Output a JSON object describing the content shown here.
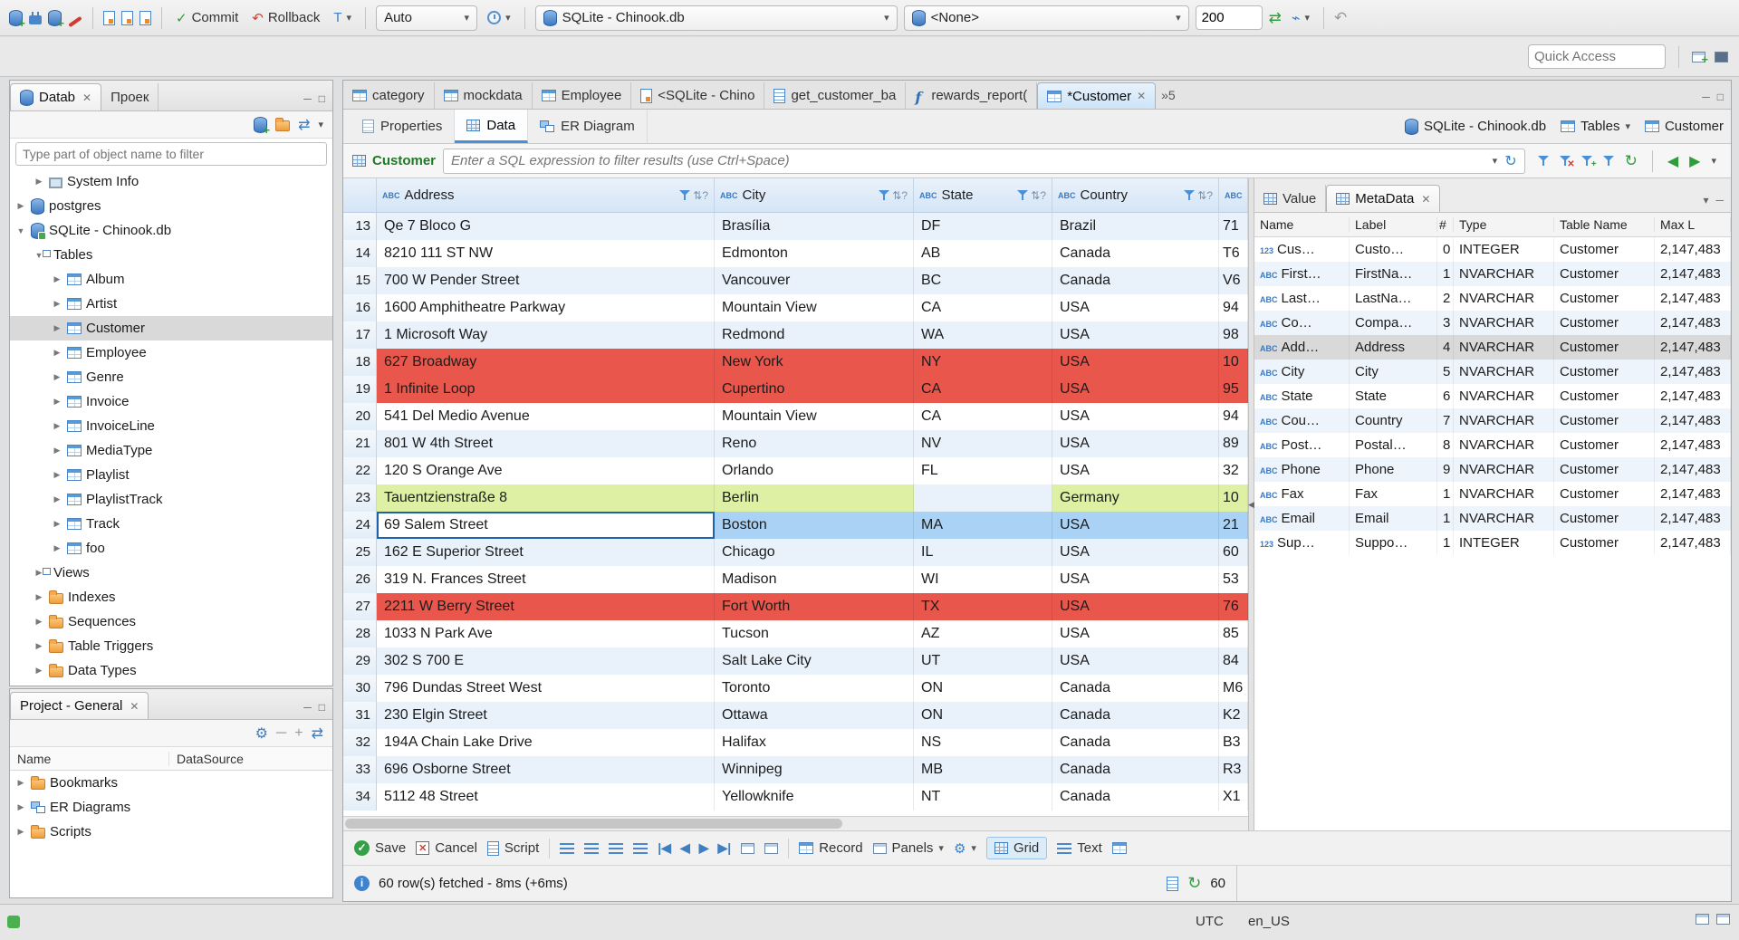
{
  "icons": {
    "caret_down": "▾",
    "close": "✕",
    "check": "✓",
    "minimize": "─",
    "restore": "□",
    "sort": "⇅?",
    "nav_first": "|◀",
    "nav_prev": "◀",
    "nav_next": "▶",
    "nav_last": "▶|",
    "refresh": "↻",
    "gear": "⚙",
    "info": "i",
    "undo": "↶",
    "back_arrow": "◀",
    "forward_arrow": "▶",
    "splitter_arrow": "◀",
    "swap": "⇄",
    "x_small": "✕",
    "plus_small": "+"
  },
  "toolbar": {
    "commit_label": "Commit",
    "rollback_label": "Rollback",
    "txn_label": "T",
    "auto_label": "Auto",
    "db_combo": "SQLite - Chinook.db",
    "schema_combo": "<None>",
    "fetch_size": "200",
    "quick_access_placeholder": "Quick Access"
  },
  "navigator": {
    "db_tab": "Datab",
    "project_tab": "Проек",
    "filter_placeholder": "Type part of object name to filter",
    "tree": [
      {
        "label": "System Info",
        "depth": 1,
        "arrow": "▶",
        "icon": "sysinfo"
      },
      {
        "label": "postgres",
        "depth": 0,
        "arrow": "▶",
        "icon": "db"
      },
      {
        "label": "SQLite - Chinook.db",
        "depth": 0,
        "arrow": "▼",
        "icon": "db-active"
      },
      {
        "label": "Tables",
        "depth": 1,
        "arrow": "▼",
        "icon": "folder-tables"
      },
      {
        "label": "Album",
        "depth": 2,
        "arrow": "▶",
        "icon": "table"
      },
      {
        "label": "Artist",
        "depth": 2,
        "arrow": "▶",
        "icon": "table"
      },
      {
        "label": "Customer",
        "depth": 2,
        "arrow": "▶",
        "icon": "table",
        "selected": true
      },
      {
        "label": "Employee",
        "depth": 2,
        "arrow": "▶",
        "icon": "table"
      },
      {
        "label": "Genre",
        "depth": 2,
        "arrow": "▶",
        "icon": "table"
      },
      {
        "label": "Invoice",
        "depth": 2,
        "arrow": "▶",
        "icon": "table"
      },
      {
        "label": "InvoiceLine",
        "depth": 2,
        "arrow": "▶",
        "icon": "table"
      },
      {
        "label": "MediaType",
        "depth": 2,
        "arrow": "▶",
        "icon": "table"
      },
      {
        "label": "Playlist",
        "depth": 2,
        "arrow": "▶",
        "icon": "table"
      },
      {
        "label": "PlaylistTrack",
        "depth": 2,
        "arrow": "▶",
        "icon": "table"
      },
      {
        "label": "Track",
        "depth": 2,
        "arrow": "▶",
        "icon": "table"
      },
      {
        "label": "foo",
        "depth": 2,
        "arrow": "▶",
        "icon": "table"
      },
      {
        "label": "Views",
        "depth": 1,
        "arrow": "▶",
        "icon": "folder-views"
      },
      {
        "label": "Indexes",
        "depth": 1,
        "arrow": "▶",
        "icon": "folder"
      },
      {
        "label": "Sequences",
        "depth": 1,
        "arrow": "▶",
        "icon": "folder"
      },
      {
        "label": "Table Triggers",
        "depth": 1,
        "arrow": "▶",
        "icon": "folder"
      },
      {
        "label": "Data Types",
        "depth": 1,
        "arrow": "▶",
        "icon": "folder"
      }
    ]
  },
  "project_panel": {
    "title": "Project - General",
    "name_col": "Name",
    "datasource_col": "DataSource",
    "items": [
      {
        "label": "Bookmarks",
        "icon": "folder"
      },
      {
        "label": "ER Diagrams",
        "icon": "diagram"
      },
      {
        "label": "Scripts",
        "icon": "folder"
      }
    ]
  },
  "editor": {
    "tabs": [
      {
        "label": "category",
        "icon": "table"
      },
      {
        "label": "mockdata",
        "icon": "table"
      },
      {
        "label": "Employee",
        "icon": "table"
      },
      {
        "label": "<SQLite - Chino",
        "icon": "sql"
      },
      {
        "label": "get_customer_ba",
        "icon": "script"
      },
      {
        "label": "rewards_report(",
        "icon": "function"
      },
      {
        "label": "*Customer",
        "icon": "table",
        "active": true,
        "closable": true
      }
    ],
    "overflow": "»5",
    "subtabs": [
      {
        "label": "Properties",
        "icon": "props"
      },
      {
        "label": "Data",
        "icon": "grid",
        "active": true
      },
      {
        "label": "ER Diagram",
        "icon": "er"
      }
    ],
    "context_db": "SQLite - Chinook.db",
    "context_container": "Tables",
    "context_entity": "Customer"
  },
  "filter_bar": {
    "entity": "Customer",
    "placeholder": "Enter a SQL expression to filter results (use Ctrl+Space)"
  },
  "grid": {
    "columns": [
      {
        "label": "Address",
        "type": "ABC"
      },
      {
        "label": "City",
        "type": "ABC"
      },
      {
        "label": "State",
        "type": "ABC"
      },
      {
        "label": "Country",
        "type": "ABC"
      },
      {
        "label": "",
        "type": "ABC"
      }
    ],
    "rows": [
      {
        "num": "13",
        "address": "Qe 7 Bloco G",
        "city": "Brasília",
        "state": "DF",
        "country": "Brazil",
        "postal": "71",
        "hl": "odd"
      },
      {
        "num": "14",
        "address": "8210 111 ST NW",
        "city": "Edmonton",
        "state": "AB",
        "country": "Canada",
        "postal": "T6",
        "hl": "even"
      },
      {
        "num": "15",
        "address": "700 W Pender Street",
        "city": "Vancouver",
        "state": "BC",
        "country": "Canada",
        "postal": "V6",
        "hl": "odd"
      },
      {
        "num": "16",
        "address": "1600 Amphitheatre Parkway",
        "city": "Mountain View",
        "state": "CA",
        "country": "USA",
        "postal": "94",
        "hl": "even"
      },
      {
        "num": "17",
        "address": "1 Microsoft Way",
        "city": "Redmond",
        "state": "WA",
        "country": "USA",
        "postal": "98",
        "hl": "odd"
      },
      {
        "num": "18",
        "address": "627 Broadway",
        "city": "New York",
        "state": "NY",
        "country": "USA",
        "postal": "10",
        "hl": "red"
      },
      {
        "num": "19",
        "address": "1 Infinite Loop",
        "city": "Cupertino",
        "state": "CA",
        "country": "USA",
        "postal": "95",
        "hl": "red"
      },
      {
        "num": "20",
        "address": "541 Del Medio Avenue",
        "city": "Mountain View",
        "state": "CA",
        "country": "USA",
        "postal": "94",
        "hl": "even"
      },
      {
        "num": "21",
        "address": "801 W 4th Street",
        "city": "Reno",
        "state": "NV",
        "country": "USA",
        "postal": "89",
        "hl": "odd"
      },
      {
        "num": "22",
        "address": "120 S Orange Ave",
        "city": "Orlando",
        "state": "FL",
        "country": "USA",
        "postal": "32",
        "hl": "even"
      },
      {
        "num": "23",
        "address": "Tauentzienstraße 8",
        "city": "Berlin",
        "state": "",
        "country": "Germany",
        "postal": "10",
        "hl": "green"
      },
      {
        "num": "24",
        "address": "69 Salem Street",
        "city": "Boston",
        "state": "MA",
        "country": "USA",
        "postal": "21",
        "hl": "selected"
      },
      {
        "num": "25",
        "address": "162 E Superior Street",
        "city": "Chicago",
        "state": "IL",
        "country": "USA",
        "postal": "60",
        "hl": "odd"
      },
      {
        "num": "26",
        "address": "319 N. Frances Street",
        "city": "Madison",
        "state": "WI",
        "country": "USA",
        "postal": "53",
        "hl": "even"
      },
      {
        "num": "27",
        "address": "2211 W Berry Street",
        "city": "Fort Worth",
        "state": "TX",
        "country": "USA",
        "postal": "76",
        "hl": "red"
      },
      {
        "num": "28",
        "address": "1033 N Park Ave",
        "city": "Tucson",
        "state": "AZ",
        "country": "USA",
        "postal": "85",
        "hl": "even"
      },
      {
        "num": "29",
        "address": "302 S 700 E",
        "city": "Salt Lake City",
        "state": "UT",
        "country": "USA",
        "postal": "84",
        "hl": "odd"
      },
      {
        "num": "30",
        "address": "796 Dundas Street West",
        "city": "Toronto",
        "state": "ON",
        "country": "Canada",
        "postal": "M6",
        "hl": "even"
      },
      {
        "num": "31",
        "address": "230 Elgin Street",
        "city": "Ottawa",
        "state": "ON",
        "country": "Canada",
        "postal": "K2",
        "hl": "odd"
      },
      {
        "num": "32",
        "address": "194A Chain Lake Drive",
        "city": "Halifax",
        "state": "NS",
        "country": "Canada",
        "postal": "B3",
        "hl": "even"
      },
      {
        "num": "33",
        "address": "696 Osborne Street",
        "city": "Winnipeg",
        "state": "MB",
        "country": "Canada",
        "postal": "R3",
        "hl": "odd"
      },
      {
        "num": "34",
        "address": "5112 48 Street",
        "city": "Yellowknife",
        "state": "NT",
        "country": "Canada",
        "postal": "X1",
        "hl": "even"
      }
    ]
  },
  "value_panel": {
    "value_tab": "Value",
    "metadata_tab": "MetaData",
    "columns": [
      "Name",
      "Label",
      "#",
      "Type",
      "Table Name",
      "Max L"
    ],
    "rows": [
      {
        "prefix": "123",
        "name": "Cus…",
        "label": "Custo…",
        "num": "0",
        "type": "INTEGER",
        "table": "Customer",
        "max": "2,147,483"
      },
      {
        "prefix": "ABC",
        "name": "First…",
        "label": "FirstNa…",
        "num": "1",
        "type": "NVARCHAR",
        "table": "Customer",
        "max": "2,147,483"
      },
      {
        "prefix": "ABC",
        "name": "Last…",
        "label": "LastNa…",
        "num": "2",
        "type": "NVARCHAR",
        "table": "Customer",
        "max": "2,147,483"
      },
      {
        "prefix": "ABC",
        "name": "Co…",
        "label": "Compa…",
        "num": "3",
        "type": "NVARCHAR",
        "table": "Customer",
        "max": "2,147,483"
      },
      {
        "prefix": "ABC",
        "name": "Add…",
        "label": "Address",
        "num": "4",
        "type": "NVARCHAR",
        "table": "Customer",
        "max": "2,147,483",
        "selected": true
      },
      {
        "prefix": "ABC",
        "name": "City",
        "label": "City",
        "num": "5",
        "type": "NVARCHAR",
        "table": "Customer",
        "max": "2,147,483"
      },
      {
        "prefix": "ABC",
        "name": "State",
        "label": "State",
        "num": "6",
        "type": "NVARCHAR",
        "table": "Customer",
        "max": "2,147,483"
      },
      {
        "prefix": "ABC",
        "name": "Cou…",
        "label": "Country",
        "num": "7",
        "type": "NVARCHAR",
        "table": "Customer",
        "max": "2,147,483"
      },
      {
        "prefix": "ABC",
        "name": "Post…",
        "label": "Postal…",
        "num": "8",
        "type": "NVARCHAR",
        "table": "Customer",
        "max": "2,147,483"
      },
      {
        "prefix": "ABC",
        "name": "Phone",
        "label": "Phone",
        "num": "9",
        "type": "NVARCHAR",
        "table": "Customer",
        "max": "2,147,483"
      },
      {
        "prefix": "ABC",
        "name": "Fax",
        "label": "Fax",
        "num": "1",
        "type": "NVARCHAR",
        "table": "Customer",
        "max": "2,147,483"
      },
      {
        "prefix": "ABC",
        "name": "Email",
        "label": "Email",
        "num": "1",
        "type": "NVARCHAR",
        "table": "Customer",
        "max": "2,147,483"
      },
      {
        "prefix": "123",
        "name": "Sup…",
        "label": "Suppo…",
        "num": "1",
        "type": "INTEGER",
        "table": "Customer",
        "max": "2,147,483"
      }
    ]
  },
  "result_toolbar": {
    "save": "Save",
    "cancel": "Cancel",
    "script": "Script",
    "record": "Record",
    "panels": "Panels",
    "grid": "Grid",
    "text": "Text"
  },
  "status": {
    "fetched": "60 row(s) fetched - 8ms (+6ms)",
    "row_count": "60"
  },
  "statusbar": {
    "timezone": "UTC",
    "locale": "en_US"
  }
}
